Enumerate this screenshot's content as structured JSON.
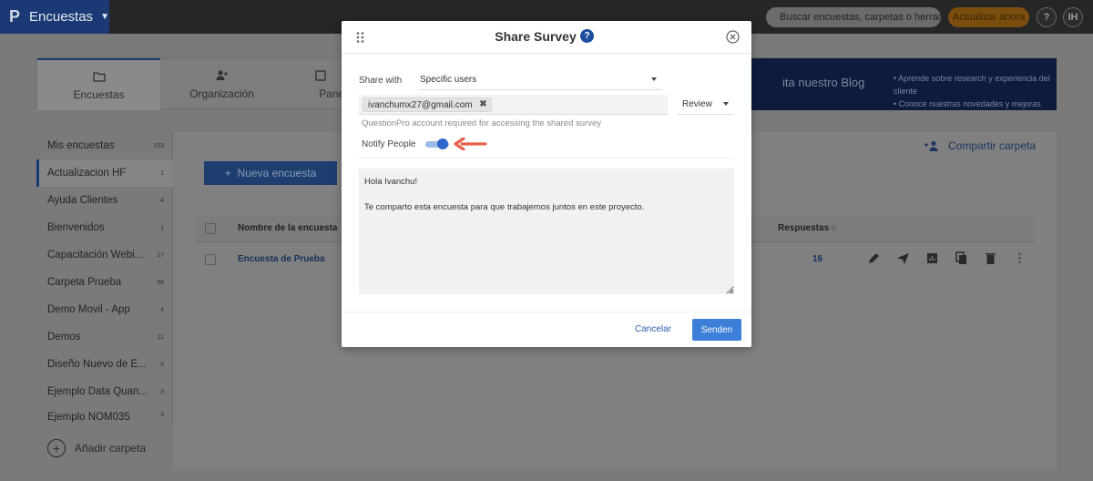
{
  "topbar": {
    "logo_letter": "P",
    "app_name": "Encuestas",
    "search_placeholder": "Buscar encuestas, carpetas o herrami",
    "upgrade_label": "Actualizar ahora",
    "help_label": "?",
    "user_initials": "IH"
  },
  "tabs": [
    {
      "label": "Encuestas",
      "icon": "folder-icon"
    },
    {
      "label": "Organización",
      "icon": "users-icon"
    },
    {
      "label": "Panel",
      "icon": "panel-icon"
    }
  ],
  "blog": {
    "title": "ita nuestro Blog",
    "bullets": [
      "Aprende sobre research y experiencia del cliente",
      "Conoce nuestras novedades y mejoras"
    ]
  },
  "sidebar": {
    "items": [
      {
        "label": "Mis encuestas",
        "count": "153"
      },
      {
        "label": "Actualizacion HF",
        "count": "1"
      },
      {
        "label": "Ayuda Clientes",
        "count": "4"
      },
      {
        "label": "Bienvenidos",
        "count": "1"
      },
      {
        "label": "Capacitación Webi...",
        "count": "17"
      },
      {
        "label": "Carpeta Prueba",
        "count": "98"
      },
      {
        "label": "Demo Movil - App",
        "count": "4"
      },
      {
        "label": "Demos",
        "count": "11"
      },
      {
        "label": "Diseño Nuevo de E...",
        "count": "5"
      },
      {
        "label": "Ejemplo Data Quan...",
        "count": "3"
      },
      {
        "label": "Ejemplo NOM035",
        "count": "3"
      }
    ],
    "add_folder_label": "Añadir carpeta"
  },
  "main": {
    "share_folder_label": "Compartir carpeta",
    "new_survey_label": "Nueva encuesta",
    "table": {
      "col_name": "Nombre de la encuesta",
      "col_responses": "Respuestas",
      "col_responses_sort": "0",
      "rows": [
        {
          "name": "Encuesta de Prueba",
          "responses": "16"
        }
      ]
    }
  },
  "modal": {
    "title": "Share Survey",
    "help_label": "?",
    "share_with_label": "Share with",
    "share_with_value": "Specific users",
    "recipient_email": "ivanchumx27@gmail.com",
    "role_value": "Review",
    "hint": "QuestionPro account required for accessing the shared survey",
    "notify_label": "Notify People",
    "notify_on": true,
    "message": "Hola Ivanchu!\n\nTe comparto esta encuesta para que trabajemos juntos en este proyecto.",
    "cancel_label": "Cancelar",
    "send_label": "Senden"
  },
  "colors": {
    "brand": "#1c4ea0",
    "accent_button": "#3b7fd9",
    "upgrade": "#f5a623",
    "annotation_arrow": "#e8604c"
  }
}
